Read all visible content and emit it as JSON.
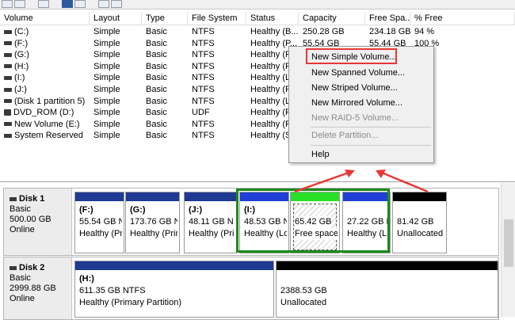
{
  "volume_list": {
    "columns": [
      "Volume",
      "Layout",
      "Type",
      "File System",
      "Status",
      "Capacity",
      "Free Spa...",
      "% Free"
    ],
    "rows": [
      {
        "volume": "(C:)",
        "layout": "Simple",
        "type": "Basic",
        "fs": "NTFS",
        "status": "Healthy (B...",
        "capacity": "250.28 GB",
        "free": "234.18 GB",
        "pct": "94 %"
      },
      {
        "volume": "(F:)",
        "layout": "Simple",
        "type": "Basic",
        "fs": "NTFS",
        "status": "Healthy (P...",
        "capacity": "55.54 GB",
        "free": "55.44 GB",
        "pct": "100 %"
      },
      {
        "volume": "(G:)",
        "layout": "Simple",
        "type": "Basic",
        "fs": "NTFS",
        "status": "Healthy (P...",
        "capacity": "",
        "free": "",
        "pct": "%"
      },
      {
        "volume": "(H:)",
        "layout": "Simple",
        "type": "Basic",
        "fs": "NTFS",
        "status": "Healthy (P...",
        "capacity": "",
        "free": "",
        "pct": "%"
      },
      {
        "volume": "(I:)",
        "layout": "Simple",
        "type": "Basic",
        "fs": "NTFS",
        "status": "Healthy (L...",
        "capacity": "",
        "free": "",
        "pct": "%"
      },
      {
        "volume": "(J:)",
        "layout": "Simple",
        "type": "Basic",
        "fs": "NTFS",
        "status": "Healthy (P...",
        "capacity": "",
        "free": "",
        "pct": "%"
      },
      {
        "volume": "(Disk 1 partition 5)",
        "layout": "Simple",
        "type": "Basic",
        "fs": "NTFS",
        "status": "Healthy (L...",
        "capacity": "",
        "free": "",
        "pct": "%"
      },
      {
        "volume": "DVD_ROM (D:)",
        "layout": "Simple",
        "type": "Basic",
        "fs": "UDF",
        "status": "Healthy (P...",
        "capacity": "",
        "free": "",
        "pct": "%"
      },
      {
        "volume": "New Volume (E:)",
        "layout": "Simple",
        "type": "Basic",
        "fs": "NTFS",
        "status": "Healthy (P...",
        "capacity": "",
        "free": "",
        "pct": "%"
      },
      {
        "volume": "System Reserved",
        "layout": "Simple",
        "type": "Basic",
        "fs": "NTFS",
        "status": "Healthy (S...",
        "capacity": "",
        "free": "",
        "pct": "%"
      }
    ]
  },
  "context_menu": {
    "items": [
      {
        "label": "New Simple Volume...",
        "enabled": true
      },
      {
        "label": "New Spanned Volume...",
        "enabled": true
      },
      {
        "label": "New Striped Volume...",
        "enabled": true
      },
      {
        "label": "New Mirrored Volume...",
        "enabled": true
      },
      {
        "label": "New RAID-5 Volume...",
        "enabled": false
      },
      {
        "label": "Delete Partition...",
        "enabled": false
      },
      {
        "label": "Help",
        "enabled": true
      }
    ]
  },
  "disks": [
    {
      "name": "Disk 1",
      "type": "Basic",
      "size": "500.00 GB",
      "status": "Online",
      "partitions": [
        {
          "label": "(F:)",
          "size": "55.54 GB NT",
          "status": "Healthy (Pri",
          "bar": "#1f3a93"
        },
        {
          "label": "(G:)",
          "size": "173.76 GB NT",
          "status": "Healthy (Prin",
          "bar": "#1f3a93"
        },
        {
          "label": "(J:)",
          "size": "48.11 GB N",
          "status": "Healthy (Pri",
          "bar": "#1f3a93"
        },
        {
          "label": "(I:)",
          "size": "48.53 GB N",
          "status": "Healthy (Lo",
          "bar": "#1f3fd6"
        },
        {
          "label": "",
          "size": "65.42 GB",
          "status": "Free space",
          "bar": "#28e028"
        },
        {
          "label": "",
          "size": "27.22 GB N",
          "status": "Healthy (L",
          "bar": "#1f3fd6"
        },
        {
          "label": "",
          "size": "81.42 GB",
          "status": "Unallocated",
          "bar": "#000000"
        }
      ]
    },
    {
      "name": "Disk 2",
      "type": "Basic",
      "size": "2999.88 GB",
      "status": "Online",
      "partitions": [
        {
          "label": "(H:)",
          "size": "611.35 GB NTFS",
          "status": "Healthy (Primary Partition)",
          "bar": "#1f3a93"
        },
        {
          "label": "",
          "size": "2388.53 GB",
          "status": "Unallocated",
          "bar": "#000000"
        }
      ]
    }
  ]
}
